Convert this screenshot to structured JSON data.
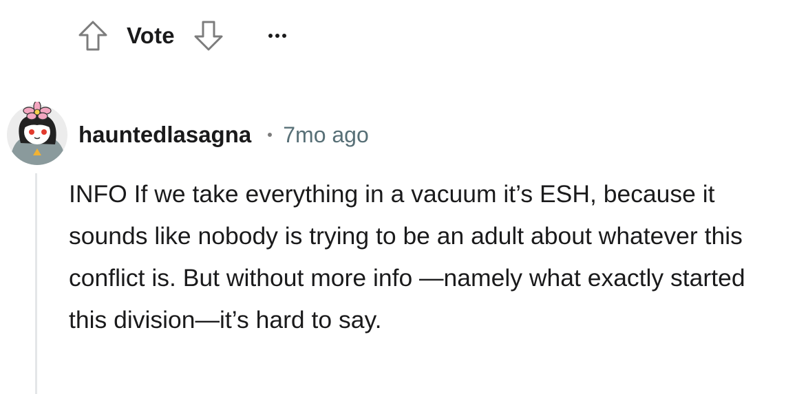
{
  "vote": {
    "label": "Vote",
    "up_icon": "arrow-up-outline",
    "down_icon": "arrow-down-outline",
    "more_icon": "ellipsis-horizontal"
  },
  "comment": {
    "avatar_icon": "user-avatar-flower-girl",
    "username": "hauntedlasagna",
    "separator": "•",
    "timestamp": "7mo ago",
    "body": "INFO If we take everything in a vacuum it’s ESH, because it sounds like nobody is trying to be an adult about whatever this conflict is. But without more info —namely what exactly started this division—it’s hard to say."
  },
  "colors": {
    "text": "#1a1a1b",
    "meta": "#576f76",
    "icon_outline": "#7c7c7c",
    "thread_line": "#e4e6e8",
    "avatar_flower": "#f4a6c0"
  }
}
